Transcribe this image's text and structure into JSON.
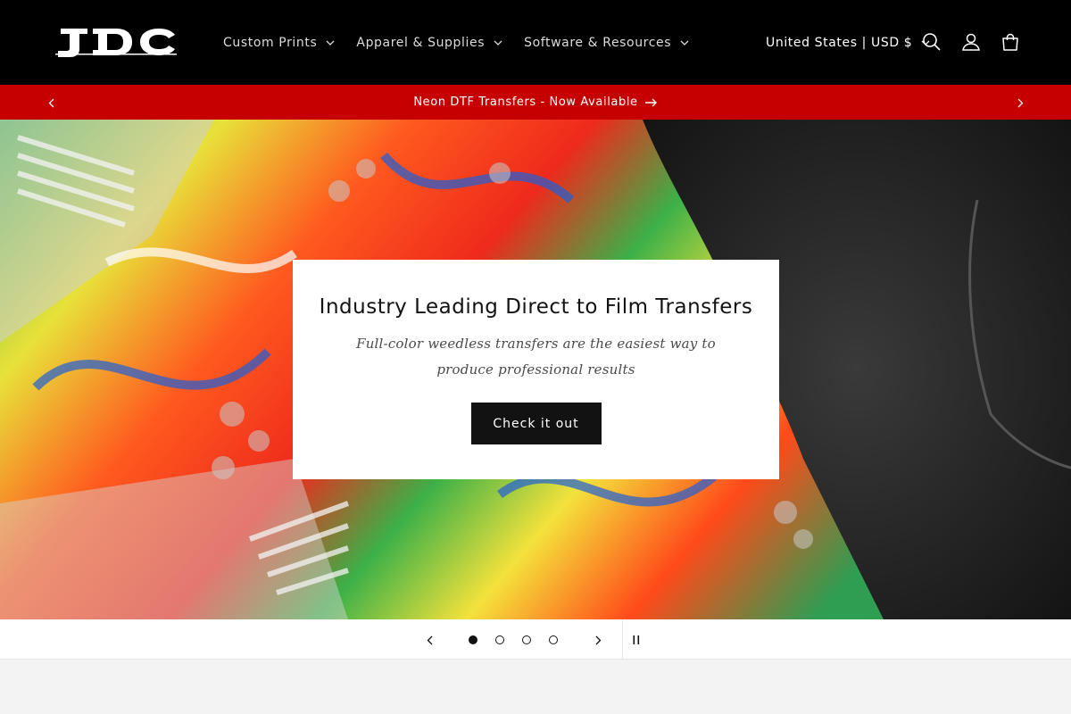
{
  "header": {
    "logo_text": "JDC",
    "nav": [
      {
        "label": "Custom Prints"
      },
      {
        "label": "Apparel & Supplies"
      },
      {
        "label": "Software & Resources"
      }
    ],
    "country_selector": "United States | USD $",
    "icons": [
      "search-icon",
      "account-icon",
      "cart-icon"
    ]
  },
  "announcement": {
    "message": "Neon DTF Transfers - Now Available",
    "background": "#c60000"
  },
  "hero": {
    "title": "Industry Leading Direct to Film Transfers",
    "subtitle": "Full-color weedless transfers are the easiest way to produce professional results",
    "cta_label": "Check it out"
  },
  "slider": {
    "slide_count": 4,
    "active_slide": 1
  },
  "colors": {
    "header_bg": "#000000",
    "accent_red": "#c60000",
    "button_bg": "#121212"
  }
}
